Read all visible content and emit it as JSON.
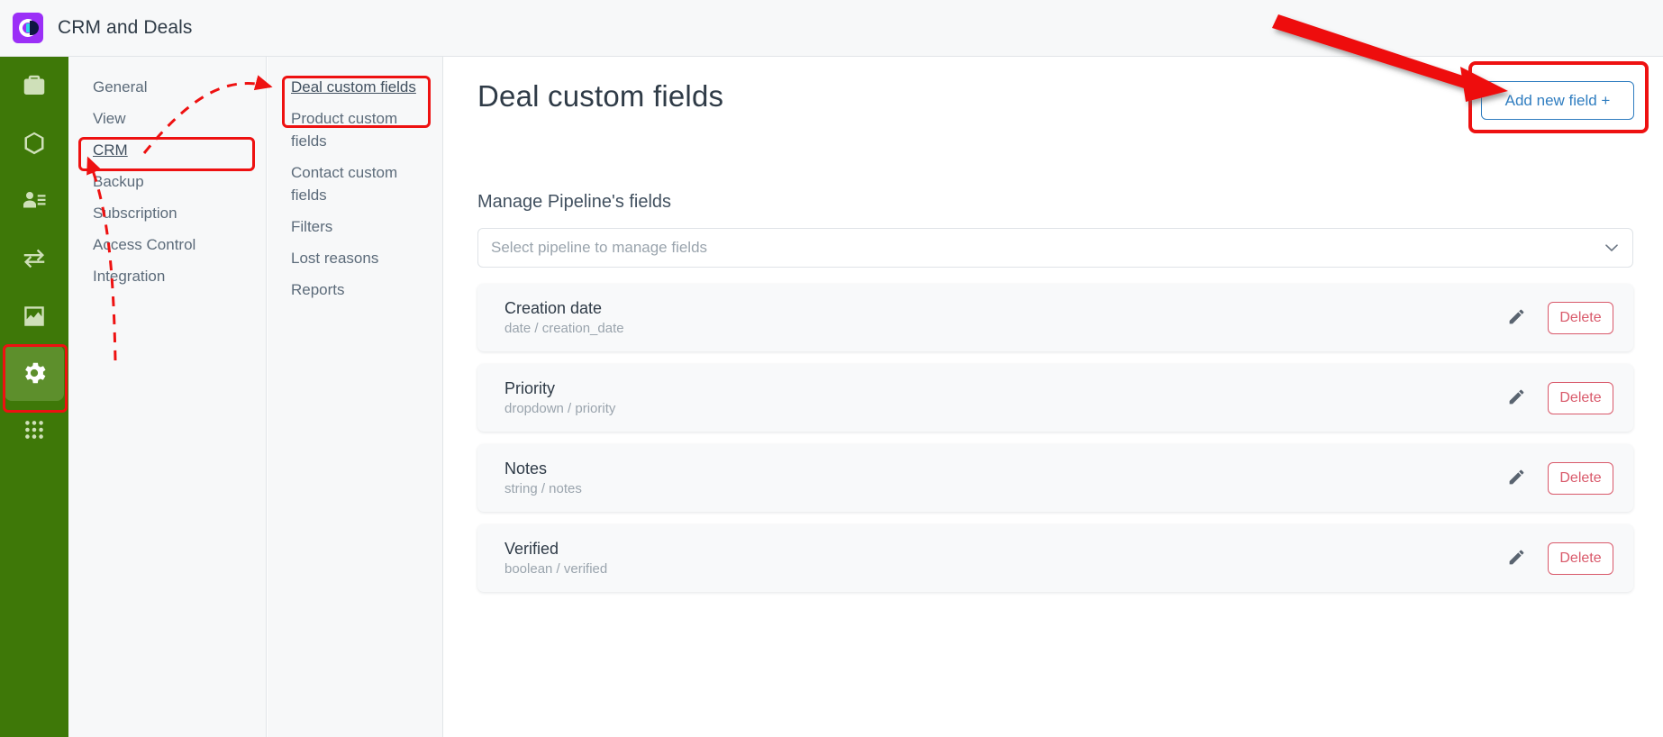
{
  "header": {
    "app_title": "CRM and Deals",
    "logo_name": "crm-deals-logo"
  },
  "rail": {
    "items": [
      {
        "icon": "briefcase-deals-icon",
        "active": false
      },
      {
        "icon": "box-product-icon",
        "active": false
      },
      {
        "icon": "contacts-icon",
        "active": false
      },
      {
        "icon": "transfer-arrows-icon",
        "active": false
      },
      {
        "icon": "analytics-chart-icon",
        "active": false
      },
      {
        "icon": "gear-settings-icon",
        "active": true
      },
      {
        "icon": "apps-grid-icon",
        "active": false
      }
    ]
  },
  "settings_menu": {
    "items": [
      {
        "label": "General",
        "selected": false
      },
      {
        "label": "View",
        "selected": false
      },
      {
        "label": "CRM",
        "selected": true
      },
      {
        "label": "Backup",
        "selected": false
      },
      {
        "label": "Subscription",
        "selected": false
      },
      {
        "label": "Access Control",
        "selected": false
      },
      {
        "label": "Integration",
        "selected": false
      }
    ]
  },
  "sub_menu": {
    "items": [
      {
        "label": "Deal custom fields",
        "selected": true
      },
      {
        "label": "Product custom fields",
        "selected": false
      },
      {
        "label": "Contact custom fields",
        "selected": false
      },
      {
        "label": "Filters",
        "selected": false
      },
      {
        "label": "Lost reasons",
        "selected": false
      },
      {
        "label": "Reports",
        "selected": false
      }
    ]
  },
  "main": {
    "title": "Deal custom fields",
    "add_button_label": "Add new field +",
    "section_label": "Manage Pipeline's fields",
    "pipeline_select": {
      "placeholder": "Select pipeline to manage fields",
      "value": "",
      "chevron_icon": "chevron-down-icon"
    },
    "fields": [
      {
        "name": "Creation date",
        "meta": "date / creation_date",
        "edit_icon": "pencil-edit-icon",
        "delete_label": "Delete"
      },
      {
        "name": "Priority",
        "meta": "dropdown / priority",
        "edit_icon": "pencil-edit-icon",
        "delete_label": "Delete"
      },
      {
        "name": "Notes",
        "meta": "string / notes",
        "edit_icon": "pencil-edit-icon",
        "delete_label": "Delete"
      },
      {
        "name": "Verified",
        "meta": "boolean / verified",
        "edit_icon": "pencil-edit-icon",
        "delete_label": "Delete"
      }
    ]
  },
  "annotations": {
    "highlight_color": "#ee1111",
    "boxes": [
      {
        "target": "gear-settings-icon"
      },
      {
        "target": "settings-menu-crm"
      },
      {
        "target": "sub-menu-deal-custom-fields"
      },
      {
        "target": "add-new-field-button"
      }
    ],
    "arrows": [
      {
        "style": "dashed",
        "from": "gear-settings-icon",
        "to": "settings-menu-crm"
      },
      {
        "style": "dashed",
        "from": "settings-menu-crm",
        "to": "sub-menu-deal-custom-fields"
      },
      {
        "style": "solid",
        "from": "top-left",
        "to": "add-new-field-button"
      }
    ]
  },
  "theme": {
    "rail_green": "#3e7808",
    "rail_active_green": "#5d8f2c",
    "logo_purple": "#9b2ff7",
    "accent_blue": "#2f7dc0",
    "danger_red": "#d9596a",
    "panel_gray": "#f7f8f9"
  }
}
